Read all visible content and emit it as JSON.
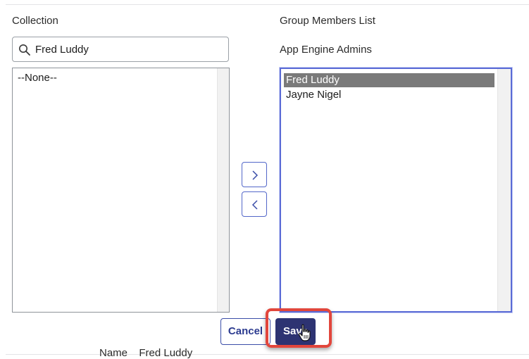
{
  "collection": {
    "label": "Collection",
    "search_value": "Fred Luddy",
    "search_placeholder": "",
    "items": [
      {
        "label": "--None--",
        "selected": false
      }
    ]
  },
  "members": {
    "label": "Group Members List",
    "group_name": "App Engine Admins",
    "items": [
      {
        "label": "Fred Luddy",
        "selected": true
      },
      {
        "label": "Jayne Nigel",
        "selected": false
      }
    ]
  },
  "buttons": {
    "add_icon": "chevron-right-icon",
    "remove_icon": "chevron-left-icon",
    "cancel_label": "Cancel",
    "save_label": "Save"
  },
  "footer": {
    "name_label": "Name",
    "name_value": "Fred Luddy"
  },
  "colors": {
    "accent": "#2d3372",
    "focus_border": "#5a6bd6",
    "highlight_box": "#e2463c",
    "selected_option": "#7a7a7a"
  }
}
